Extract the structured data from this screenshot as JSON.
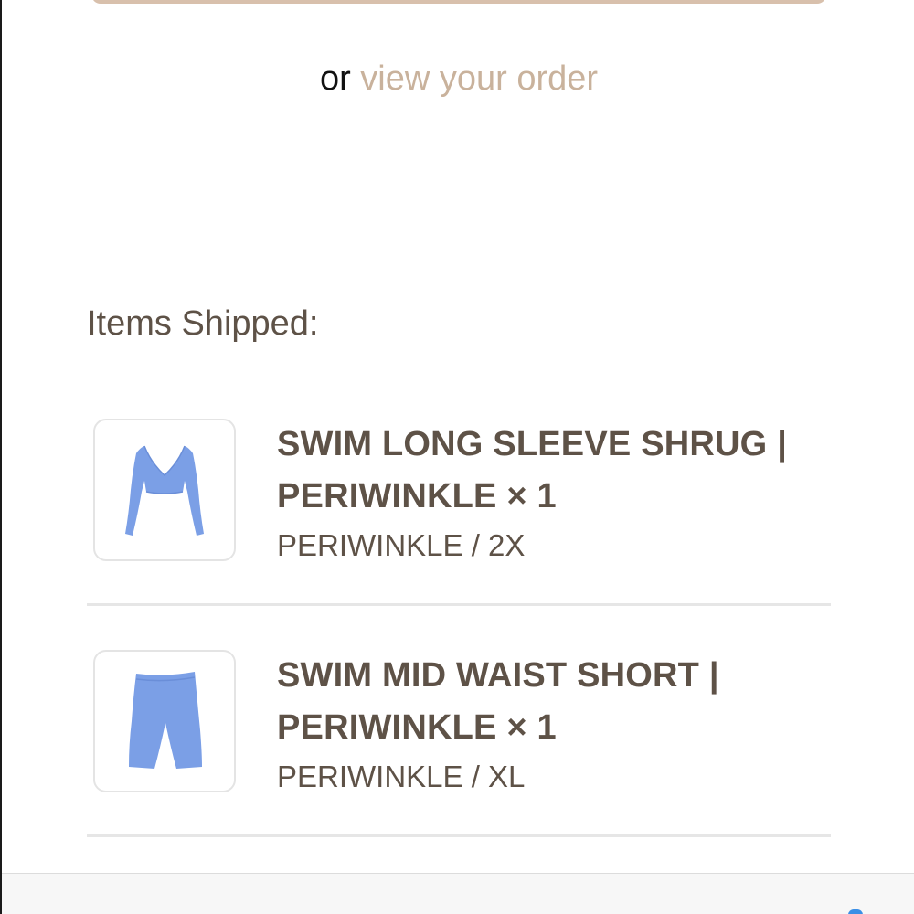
{
  "order": {
    "prefix": "or",
    "link_label": "view your order"
  },
  "shipment": {
    "section_title": "Items Shipped:",
    "items": [
      {
        "name": "SWIM LONG SLEEVE SHRUG | PERIWINKLE × 1",
        "variant": "PERIWINKLE / 2X",
        "image_icon": "long-sleeve-shrug-image"
      },
      {
        "name": "SWIM MID WAIST SHORT | PERIWINKLE × 1",
        "variant": "PERIWINKLE / XL",
        "image_icon": "mid-waist-short-image"
      }
    ]
  },
  "colors": {
    "text_primary": "#5e5247",
    "link": "#c9b29c",
    "product_periwinkle": "#7b9fe6",
    "divider": "#e6e6e6"
  }
}
